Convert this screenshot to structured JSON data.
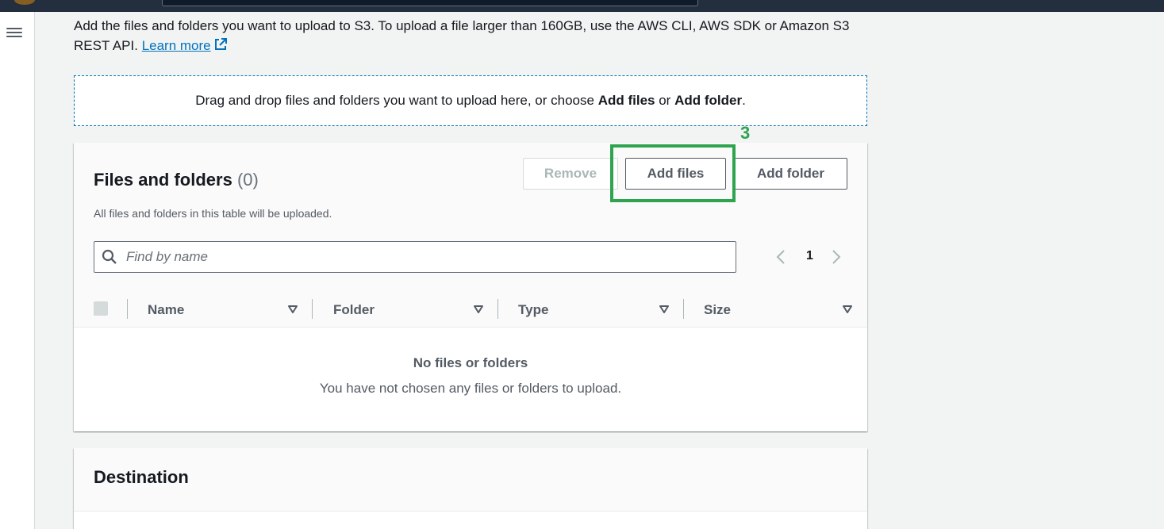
{
  "header": {
    "menu_icon": "hamburger-menu-icon"
  },
  "intro": {
    "text": "Add the files and folders you want to upload to S3. To upload a file larger than 160GB, use the AWS CLI, AWS SDK or Amazon S3 REST API.",
    "learn_more": "Learn more",
    "learn_more_icon": "external-link-icon"
  },
  "dropzone": {
    "text_before": "Drag and drop files and folders you want to upload here, or choose",
    "add_files": "Add files",
    "or": "or",
    "add_folder": "Add folder",
    "period": "."
  },
  "files_panel": {
    "title": "Files and folders",
    "count": "(0)",
    "description": "All files and folders in this table will be uploaded.",
    "remove_label": "Remove",
    "add_files_label": "Add files",
    "add_folder_label": "Add folder",
    "search_placeholder": "Find by name",
    "search_value": "",
    "page_number": "1",
    "columns": [
      "Name",
      "Folder",
      "Type",
      "Size"
    ],
    "empty_title": "No files or folders",
    "empty_description": "You have not chosen any files or folders to upload."
  },
  "annotation": {
    "step_number": "3",
    "color": "#2ea44f"
  },
  "destination": {
    "title": "Destination"
  },
  "colors": {
    "link": "#0073bb",
    "topbar": "#232f3e",
    "background": "#f2f3f3"
  }
}
